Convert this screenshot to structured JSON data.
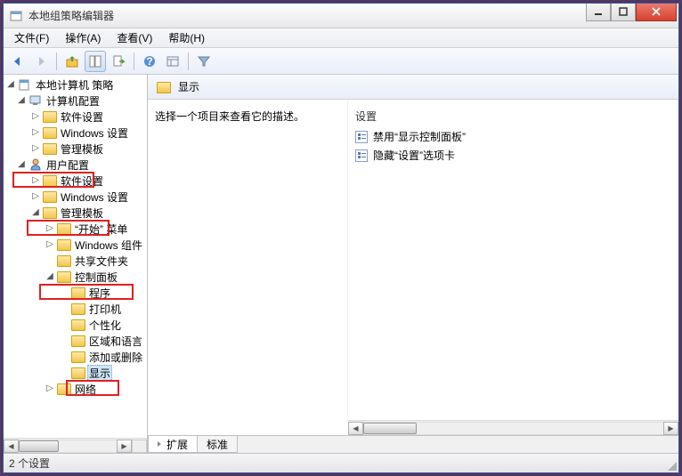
{
  "window": {
    "title": "本地组策略编辑器"
  },
  "menu": {
    "file": "文件(F)",
    "action": "操作(A)",
    "view": "查看(V)",
    "help": "帮助(H)"
  },
  "tree": {
    "root": "本地计算机 策略",
    "computer_config": "计算机配置",
    "cc_software": "软件设置",
    "cc_windows": "Windows 设置",
    "cc_admin_templates": "管理模板",
    "user_config": "用户配置",
    "uc_software": "软件设置",
    "uc_windows": "Windows 设置",
    "uc_admin_templates": "管理模板",
    "start_menu": "“开始” 菜单",
    "windows_components": "Windows 组件",
    "shared_folders": "共享文件夹",
    "control_panel": "控制面板",
    "programs": "程序",
    "printers": "打印机",
    "personalization": "个性化",
    "regional": "区域和语言",
    "add_remove": "添加或删除",
    "display": "显示",
    "network": "网络"
  },
  "right": {
    "header": "显示",
    "desc_prompt": "选择一个项目来查看它的描述。",
    "settings_header": "设置",
    "items": [
      "禁用“显示控制面板”",
      "隐藏“设置”选项卡"
    ]
  },
  "tabs": {
    "extended": "扩展",
    "standard": "标准"
  },
  "status": "2 个设置"
}
